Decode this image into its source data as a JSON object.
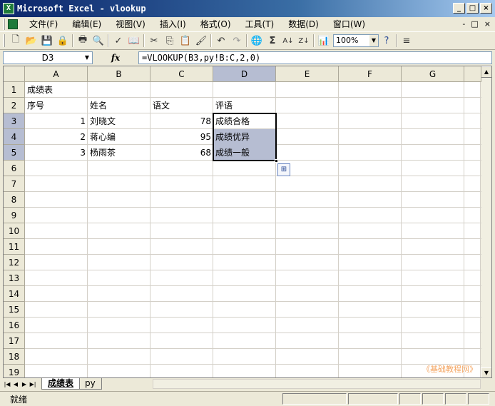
{
  "window": {
    "title": "Microsoft Excel - vlookup",
    "minimize": "_",
    "maximize": "□",
    "close": "×"
  },
  "menu": {
    "items": [
      "文件(F)",
      "编辑(E)",
      "视图(V)",
      "插入(I)",
      "格式(O)",
      "工具(T)",
      "数据(D)",
      "窗口(W)"
    ],
    "right_controls": [
      "-",
      "□",
      "×"
    ]
  },
  "toolbar": {
    "zoom": "100%"
  },
  "formula_bar": {
    "name_box": "D3",
    "fx_label": "fx",
    "formula": "=VLOOKUP(B3,py!B:C,2,0)"
  },
  "columns": [
    "A",
    "B",
    "C",
    "D",
    "E",
    "F",
    "G"
  ],
  "rows": [
    "1",
    "2",
    "3",
    "4",
    "5",
    "6",
    "7",
    "8",
    "9",
    "10",
    "11",
    "12",
    "13",
    "14",
    "15",
    "16",
    "17",
    "18",
    "19"
  ],
  "cells": {
    "A1": "成绩表",
    "A2": "序号",
    "B2": "姓名",
    "C2": "语文",
    "D2": "评语",
    "A3": "1",
    "B3": "刘晓文",
    "C3": "78",
    "D3": "成绩合格",
    "A4": "2",
    "B4": "蒋心编",
    "C4": "95",
    "D4": "成绩优异",
    "A5": "3",
    "B5": "杨雨茶",
    "C5": "68",
    "D5": "成绩一般"
  },
  "sheets": {
    "tabs": [
      "成绩表",
      "py"
    ],
    "active": "成绩表"
  },
  "watermark": "《基础教程网》",
  "status": "就绪",
  "smart_tag": "⊞"
}
